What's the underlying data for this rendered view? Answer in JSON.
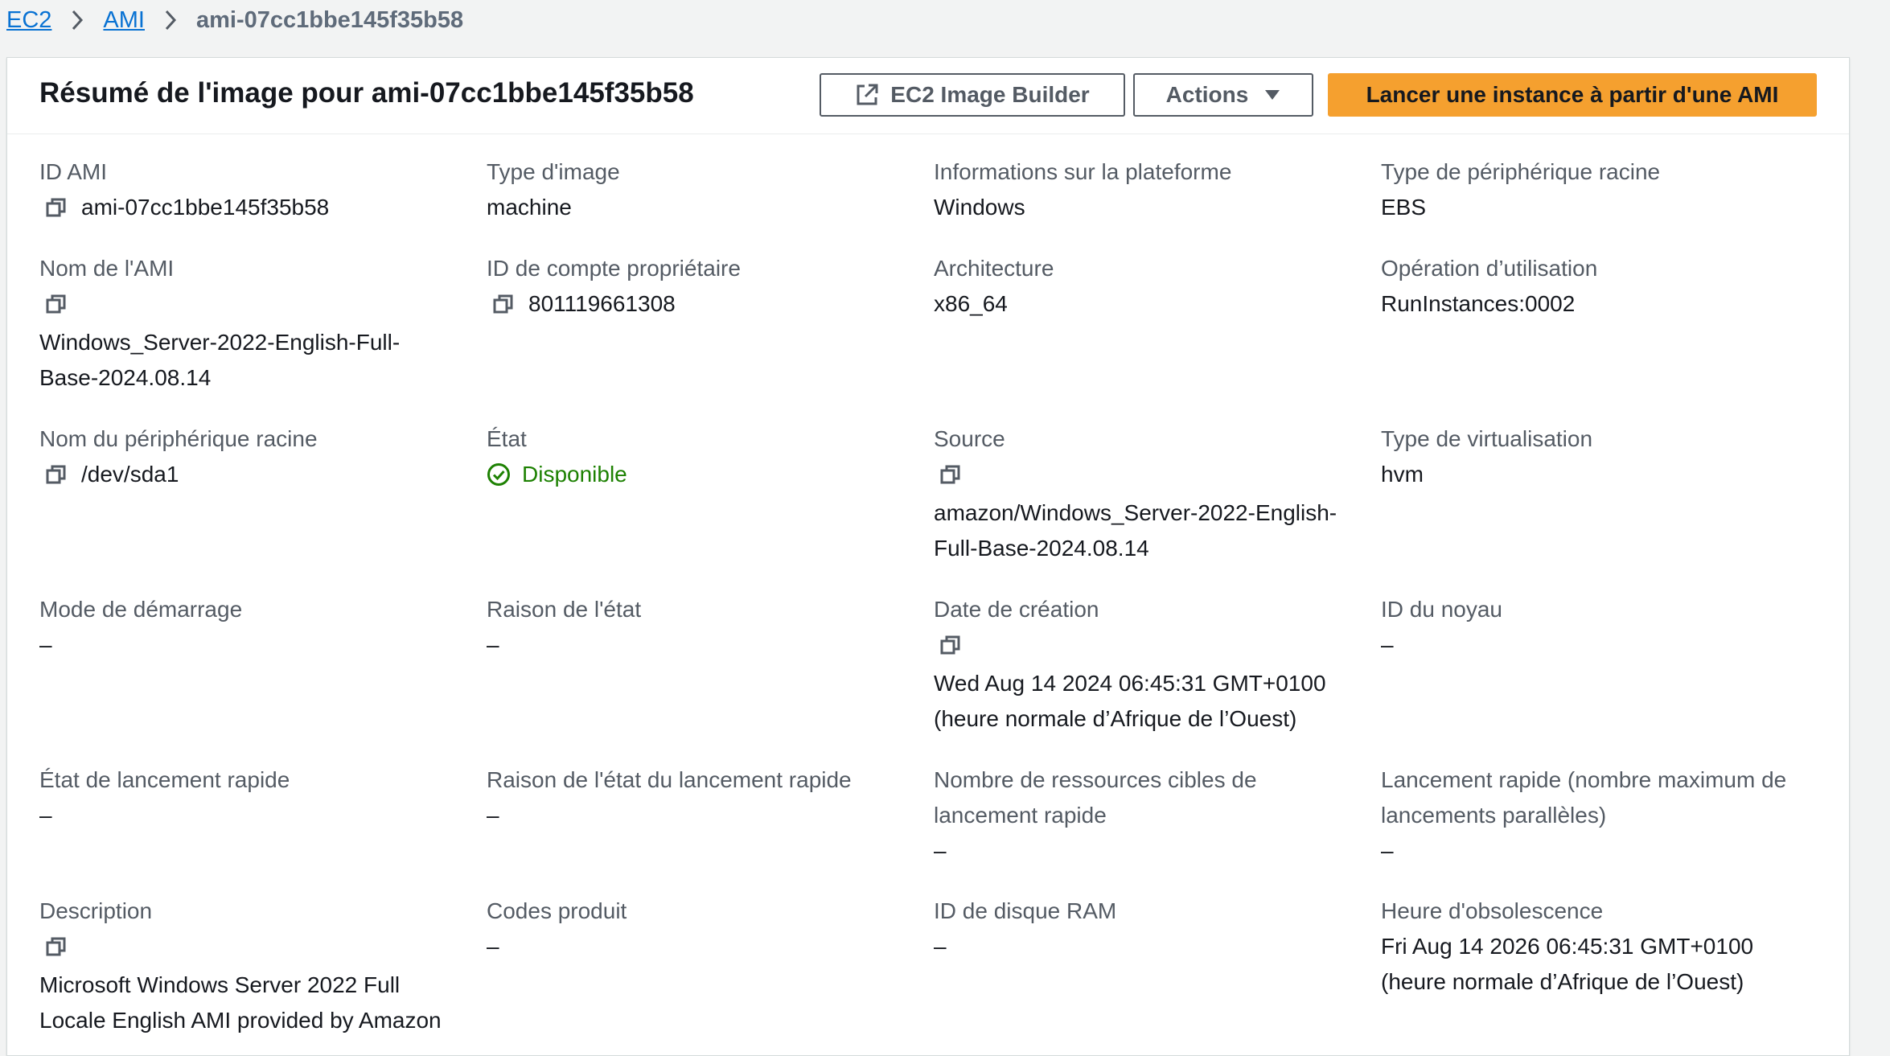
{
  "breadcrumb": {
    "items": [
      "EC2",
      "AMI"
    ],
    "current": "ami-07cc1bbe145f35b58"
  },
  "panel": {
    "title": "Résumé de l'image pour ami-07cc1bbe145f35b58",
    "buttons": {
      "image_builder": "EC2 Image Builder",
      "actions": "Actions",
      "launch": "Lancer une instance à partir d'une AMI"
    }
  },
  "fields": {
    "ami_id": {
      "label": "ID AMI",
      "value": "ami-07cc1bbe145f35b58"
    },
    "image_type": {
      "label": "Type d'image",
      "value": "machine"
    },
    "platform": {
      "label": "Informations sur la plateforme",
      "value": "Windows"
    },
    "root_device_type": {
      "label": "Type de périphérique racine",
      "value": "EBS"
    },
    "ami_name": {
      "label": "Nom de l'AMI",
      "value_line1": "Windows_Server-2022-English-Full-",
      "value_line2": "Base-2024.08.14"
    },
    "owner_id": {
      "label": "ID de compte propriétaire",
      "value": "801119661308"
    },
    "architecture": {
      "label": "Architecture",
      "value": "x86_64"
    },
    "usage_operation": {
      "label": "Opération d’utilisation",
      "value": "RunInstances:0002"
    },
    "root_device_name": {
      "label": "Nom du périphérique racine",
      "value": "/dev/sda1"
    },
    "state": {
      "label": "État",
      "value": "Disponible"
    },
    "source": {
      "label": "Source",
      "value_line1": "amazon/Windows_Server-2022-English-",
      "value_line2": "Full-Base-2024.08.14"
    },
    "virtualization": {
      "label": "Type de virtualisation",
      "value": "hvm"
    },
    "boot_mode": {
      "label": "Mode de démarrage",
      "value": "–"
    },
    "state_reason": {
      "label": "Raison de l'état",
      "value": "–"
    },
    "creation_date": {
      "label": "Date de création",
      "value_line1": "Wed Aug 14 2024 06:45:31 GMT+0100",
      "value_line2": "(heure normale d’Afrique de l’Ouest)"
    },
    "kernel_id": {
      "label": "ID du noyau",
      "value": "–"
    },
    "fast_launch_state": {
      "label": "État de lancement rapide",
      "value": "–"
    },
    "fast_launch_reason": {
      "label": "Raison de l'état du lancement rapide",
      "value": "–"
    },
    "fast_launch_targets": {
      "label_line1": "Nombre de ressources cibles de",
      "label_line2": "lancement rapide",
      "value": "–"
    },
    "fast_launch_parallel": {
      "label_line1": "Lancement rapide (nombre maximum de",
      "label_line2": "lancements parallèles)",
      "value": "–"
    },
    "description": {
      "label": "Description",
      "value_line1": "Microsoft Windows Server 2022 Full",
      "value_line2": "Locale English AMI provided by Amazon"
    },
    "product_codes": {
      "label": "Codes produit",
      "value": "–"
    },
    "ramdisk_id": {
      "label": "ID de disque RAM",
      "value": "–"
    },
    "deprecation_time": {
      "label": "Heure d'obsolescence",
      "value_line1": "Fri Aug 14 2026 06:45:31 GMT+0100",
      "value_line2": "(heure normale d’Afrique de l’Ouest)"
    }
  },
  "colors": {
    "link": "#0972d3",
    "primary_button": "#f5a02f",
    "status_ok": "#1d8102",
    "label": "#545b64"
  }
}
